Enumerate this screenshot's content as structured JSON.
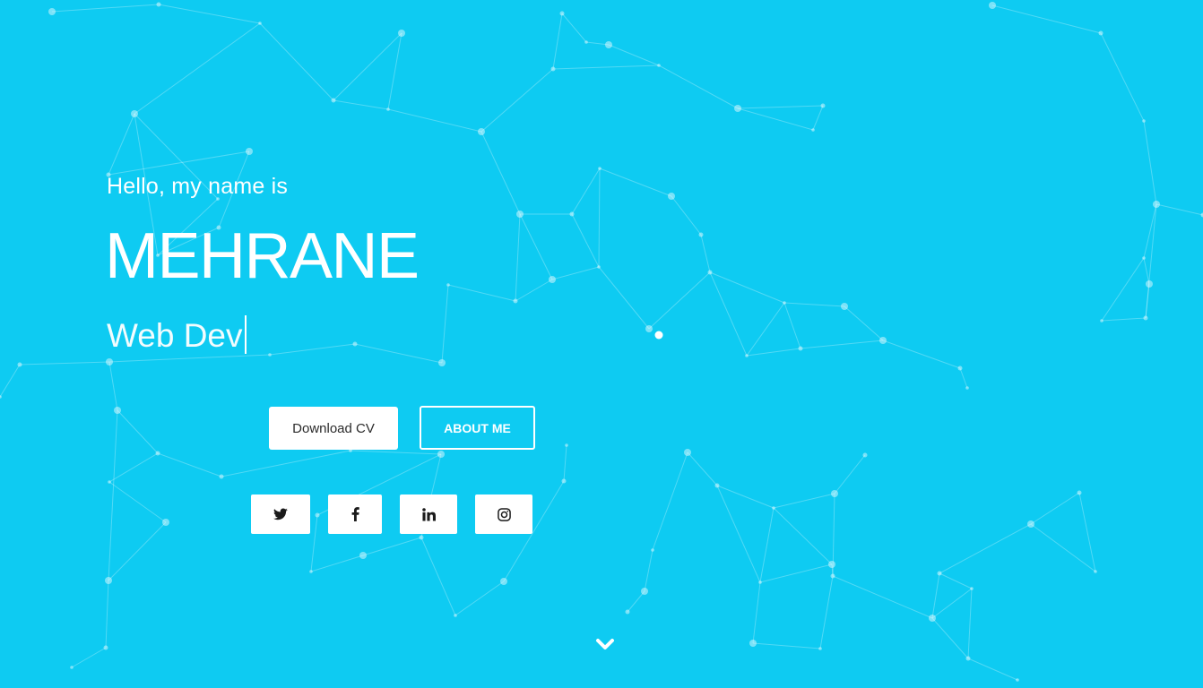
{
  "colors": {
    "background": "#0ecbf2",
    "particles": "#ffffff",
    "button_text": "#2b2b2b"
  },
  "hero": {
    "greeting": "Hello, my name is",
    "name": "MEHRANE",
    "role": "Web Dev"
  },
  "buttons": {
    "download_cv": "Download CV",
    "about_me": "ABOUT ME"
  },
  "social": [
    {
      "name": "twitter",
      "icon": "twitter-icon"
    },
    {
      "name": "facebook",
      "icon": "facebook-icon"
    },
    {
      "name": "linkedin",
      "icon": "linkedin-icon"
    },
    {
      "name": "instagram",
      "icon": "instagram-icon"
    }
  ],
  "scroll": {
    "icon": "chevron-down-icon"
  }
}
